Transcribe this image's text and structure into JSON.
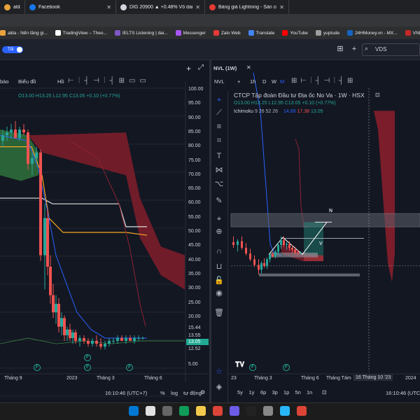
{
  "browser_tabs": [
    {
      "label": "alda - Nến tầng gi...",
      "fav": "#e8a33d",
      "w": 36
    },
    {
      "label": "Facebook",
      "fav": "#1877f2",
      "w": 130
    },
    {
      "label": "DIG 20900 ▲ +0.48% Vô danh",
      "fav": "#d1d4dc",
      "w": 127
    },
    {
      "label": "Bảng giá Lightning - Sàn cổ phiế",
      "fav": "#e53935",
      "w": 120
    }
  ],
  "bookmarks": [
    {
      "label": "alda - Nến tầng gi...",
      "color": "#e8a33d"
    },
    {
      "label": "TradingView – Theo...",
      "color": "#ffffff"
    },
    {
      "label": "IELTS Listening | dai...",
      "color": "#7e57c2"
    },
    {
      "label": "Messenger",
      "color": "#a855f7"
    },
    {
      "label": "Zalo Web",
      "color": "#e53935"
    },
    {
      "label": "Translate",
      "color": "#4285f4"
    },
    {
      "label": "YouTube",
      "color": "#ff0000"
    },
    {
      "label": "yuptude",
      "color": "#9e9e9e"
    },
    {
      "label": "24HMoney.vn - MX...",
      "color": "#1565c0"
    },
    {
      "label": "VNDIR",
      "color": "#c62828"
    }
  ],
  "header": {
    "toggle_label": "Tối",
    "search_value": "VDS"
  },
  "left": {
    "toolbar": {
      "tab1": "bào",
      "tab2": "Biểu đồ",
      "tab3": "Hồ",
      "plus": "+",
      "expand": "⤢"
    },
    "price_ticks": [
      "100.00",
      "95.00",
      "90.00",
      "85.00",
      "80.00",
      "75.00",
      "70.00",
      "65.00",
      "60.00",
      "55.00",
      "50.00",
      "45.00",
      "40.00",
      "35.00",
      "30.00",
      "25.00",
      "20.00",
      "5.00"
    ],
    "price_badges": [
      {
        "text": "15.44",
        "bg": "#131722",
        "fg": "#d1d4dc"
      },
      {
        "text": "13.55",
        "bg": "#131722",
        "fg": "#d1d4dc"
      },
      {
        "text": "13.05",
        "bg": "#22ab94",
        "fg": "#ffffff"
      },
      {
        "text": "12.52",
        "bg": "#131722",
        "fg": "#d1d4dc"
      }
    ],
    "ohlc": {
      "o": "O13.00",
      "h": "H13.25",
      "l": "L12.95",
      "c": "C13.05",
      "chg": "+0.10 (+0.77%)"
    },
    "time_labels": [
      "Tháng 9",
      "2023",
      "Tháng 3",
      "Tháng 6"
    ],
    "clock": "16:10:46 (UTC+7)",
    "bottom_opts": [
      "%",
      "log",
      "tự động"
    ]
  },
  "right": {
    "tab_label": "NVL (1W)",
    "symbol": "NVL",
    "intervals": [
      "1h",
      "D",
      "W",
      "M"
    ],
    "title": "CTCP Tập đoàn Đầu tư Địa ốc No Va · 1W · HSX",
    "ohlc": {
      "o": "O13.00",
      "h": "H13.25",
      "l": "L12.95",
      "c": "C13.05",
      "chg": "+0.10 (+0.77%)"
    },
    "ichimoku": {
      "name": "Ichimoku",
      "params": "9 26 52 26",
      "v1": "14.89",
      "v2": "17.38",
      "v3": "13.05"
    },
    "time_labels": [
      "23",
      "Tháng 3",
      "Tháng 6",
      "Tháng Tám"
    ],
    "time_badge": "16 Tháng 10 '23",
    "time_right": "2024",
    "ranges": [
      "5y",
      "1y",
      "6p",
      "3p",
      "1p",
      "5n",
      "1n"
    ],
    "clock": "16:10:46 (UTC+",
    "markers": {
      "n": "N",
      "v": "V"
    }
  },
  "colors": {
    "bg": "#131722",
    "up": "#26a69a",
    "down": "#ef5350",
    "cloud_red": "#7b1d2a",
    "cloud_green": "#2e6b3a"
  },
  "taskbar_icons": [
    "windows-icon",
    "search-icon",
    "taskview-icon",
    "edge-icon",
    "explorer-icon",
    "chrome-icon",
    "store-icon",
    "terminal-icon",
    "settings-icon",
    "photos-icon",
    "chrome-icon"
  ]
}
